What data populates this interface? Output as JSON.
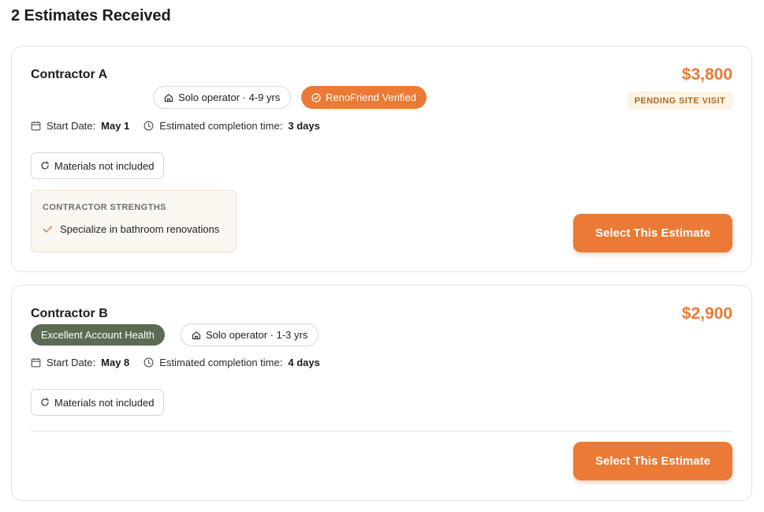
{
  "page": {
    "title": "2 Estimates Received"
  },
  "colors": {
    "accent": "#ea7a35",
    "account_health_green": "#5b6b53",
    "pending_bg": "#fcf3e4",
    "pending_text": "#b36a23"
  },
  "estimates": [
    {
      "contractor": "Contractor A",
      "price": "$3,800",
      "status": "PENDING SITE VISIT",
      "badges": [
        {
          "label": "Solo operator · 4-9 yrs",
          "icon": "house-icon"
        },
        {
          "label": "RenoFriend Verified",
          "icon": "check-circle-icon"
        }
      ],
      "start_date_label": "Start Date:",
      "start_date": "May 1",
      "completion_label": "Estimated completion time:",
      "completion": "3 days",
      "materials": "Materials not included",
      "strengths_heading": "CONTRACTOR STRENGTHS",
      "strengths": [
        "Specialize in bathroom renovations"
      ],
      "select_label": "Select This Estimate"
    },
    {
      "contractor": "Contractor B",
      "price": "$2,900",
      "badges": [
        {
          "label": "Excellent Account Health",
          "icon": ""
        },
        {
          "label": "Solo operator · 1-3 yrs",
          "icon": "house-icon"
        }
      ],
      "start_date_label": "Start Date:",
      "start_date": "May 8",
      "completion_label": "Estimated completion time:",
      "completion": "4 days",
      "materials": "Materials not included",
      "select_label": "Select This Estimate"
    }
  ]
}
